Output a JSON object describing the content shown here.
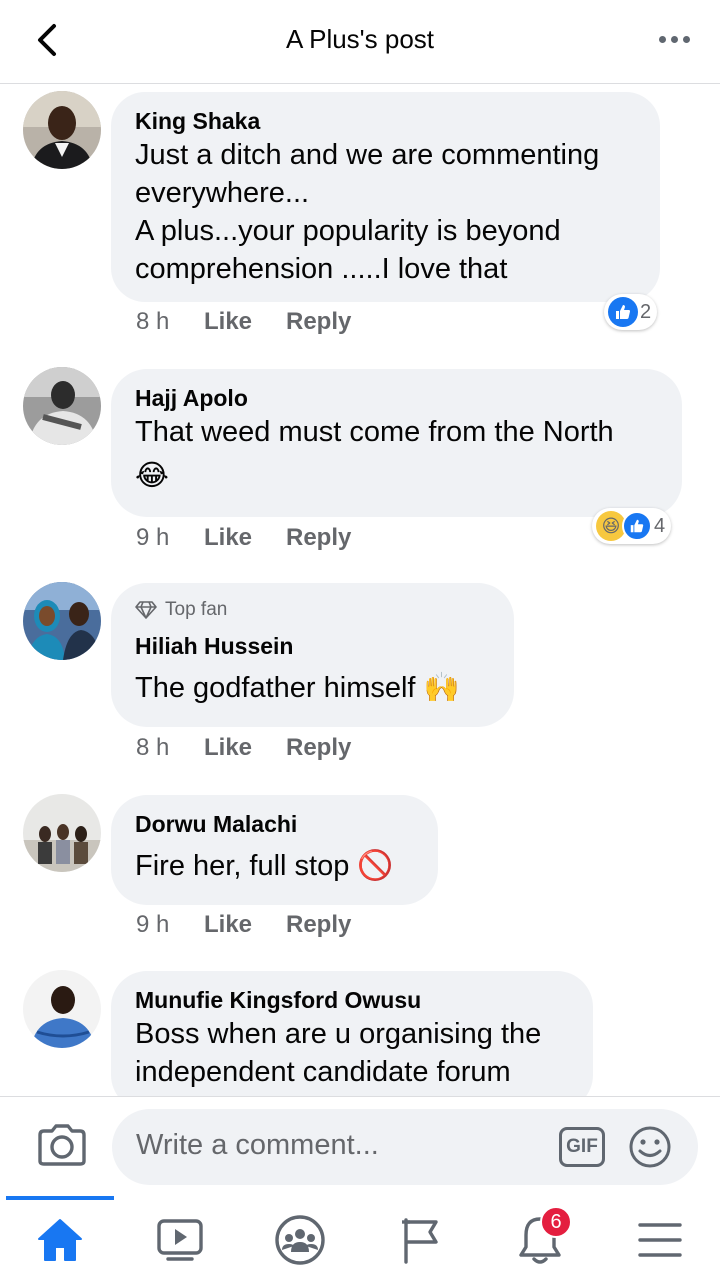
{
  "header": {
    "title": "A Plus's post"
  },
  "comments": [
    {
      "name": "King Shaka",
      "text": "Just a ditch and we are commenting\neverywhere...\nA plus...your popularity is beyond\ncomprehension .....I love that",
      "time": "8 h",
      "like": "Like",
      "reply": "Reply",
      "reaction_count": "2"
    },
    {
      "name": "Hajj Apolo",
      "text": "That weed must come from the North",
      "emoji": "😂",
      "time": "9 h",
      "like": "Like",
      "reply": "Reply",
      "reaction_count": "4"
    },
    {
      "badge": "Top fan",
      "name": "Hiliah Hussein",
      "text": "The godfather himself 🙌",
      "time": "8 h",
      "like": "Like",
      "reply": "Reply"
    },
    {
      "name": "Dorwu Malachi",
      "text": "Fire her, full stop 🚫",
      "time": "9 h",
      "like": "Like",
      "reply": "Reply"
    },
    {
      "name": "Munufie Kingsford Owusu",
      "text": "Boss when are u organising the\nindependent candidate forum"
    }
  ],
  "composer": {
    "placeholder": "Write a comment...",
    "gif_label": "GIF"
  },
  "nav": {
    "notifications_badge": "6"
  },
  "colors": {
    "accent": "#1877f2",
    "bubble": "#f0f2f5",
    "badge": "#e41e3f"
  }
}
